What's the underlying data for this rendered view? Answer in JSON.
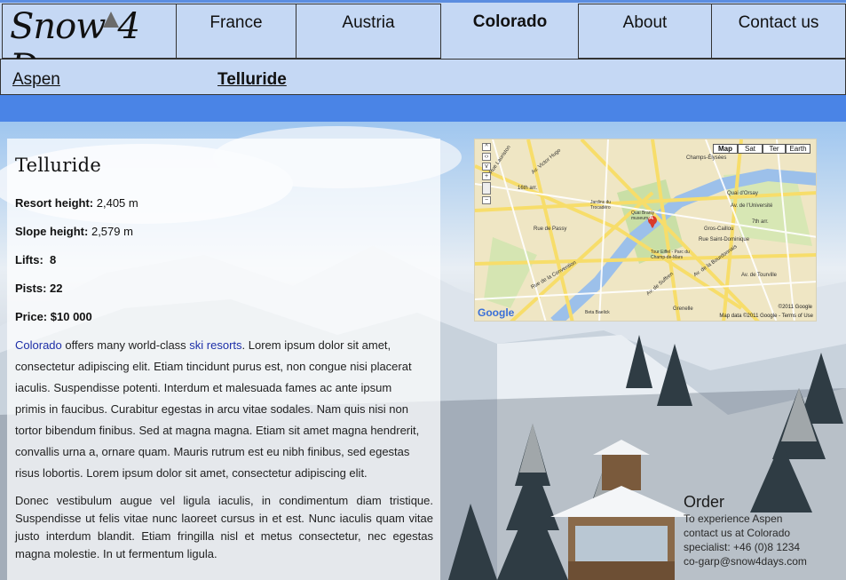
{
  "brand": {
    "logo_left": "Snow",
    "logo_mid": "4",
    "logo_right": "Days"
  },
  "nav": {
    "items": [
      {
        "label": "France"
      },
      {
        "label": "Austria"
      },
      {
        "label": "Colorado"
      },
      {
        "label": "About"
      },
      {
        "label": "Contact us"
      }
    ]
  },
  "subnav": {
    "items": [
      {
        "label": "Aspen"
      },
      {
        "label": "Telluride"
      }
    ]
  },
  "resort": {
    "title": "Telluride",
    "resort_height_label": "Resort height:",
    "resort_height_value": "2,405 m",
    "slope_height_label": "Slope height:",
    "slope_height_value": "2,579 m",
    "lifts_label": "Lifts:",
    "lifts_value": "8",
    "pists_label": "Pists:",
    "pists_value": "22",
    "price_label": "Price:",
    "price_value": "$10 000",
    "para1_link1": "Colorado",
    "para1_mid": " offers many world-class ",
    "para1_link2": "ski resorts",
    "para1_rest": ". Lorem ipsum dolor sit amet, consectetur adipiscing elit. Etiam tincidunt purus est, non congue nisi placerat iaculis. Suspendisse potenti. Interdum et malesuada fames ac ante ipsum primis in faucibus. Curabitur egestas in arcu vitae sodales. Nam quis nisi non tortor bibendum finibus. Sed at magna magna. Etiam sit amet magna hendrerit, convallis urna a, ornare quam. Mauris rutrum est eu nibh finibus, sed egestas risus lobortis. Lorem ipsum dolor sit amet, consectetur adipiscing elit.",
    "para2": "Donec vestibulum augue vel ligula iaculis, in condimentum diam tristique. Suspendisse ut felis vitae nunc laoreet cursus in et est. Nunc iaculis quam vitae justo interdum blandit. Etiam fringilla nisl et metus consectetur, nec egestas magna molestie. In ut fermentum ligula."
  },
  "map": {
    "buttons": [
      "Map",
      "Sat",
      "Ter",
      "Earth"
    ],
    "selected": "Map",
    "copyright": "©2011 Google",
    "footer": "Map data ©2011 Google - Terms of Use",
    "brand": "Google",
    "marker": "A",
    "zoom_plus": "+",
    "zoom_minus": "−",
    "labels": [
      "Champs-Élysées",
      "Rue Lauriston",
      "Av. Victor Hugo",
      "16th arr.",
      "Jardins du Trocadéro",
      "Quai Branly museum",
      "Gros-Caillou",
      "7th arr.",
      "Tour Eiffel - Parc du Champ-de-Mars",
      "Rue de la Convention",
      "Grenelle",
      "Av. de Suffren",
      "Quai d'Orsay",
      "Av. de l'Université",
      "Av. de la Bourdonnais",
      "Rue Saint-Dominique",
      "Av. de Tourville",
      "Rue de Passy",
      "Beta Baelick"
    ]
  },
  "order": {
    "title": "Order",
    "line1": "To experience Aspen",
    "line2": "contact us at Colorado",
    "line3": "specialist: +46 (0)8 1234",
    "line4": "co-garp@snow4days.com"
  },
  "colors": {
    "nav_bg": "#c5d8f4",
    "band": "#4a84e6",
    "link": "#1d2fa8"
  }
}
